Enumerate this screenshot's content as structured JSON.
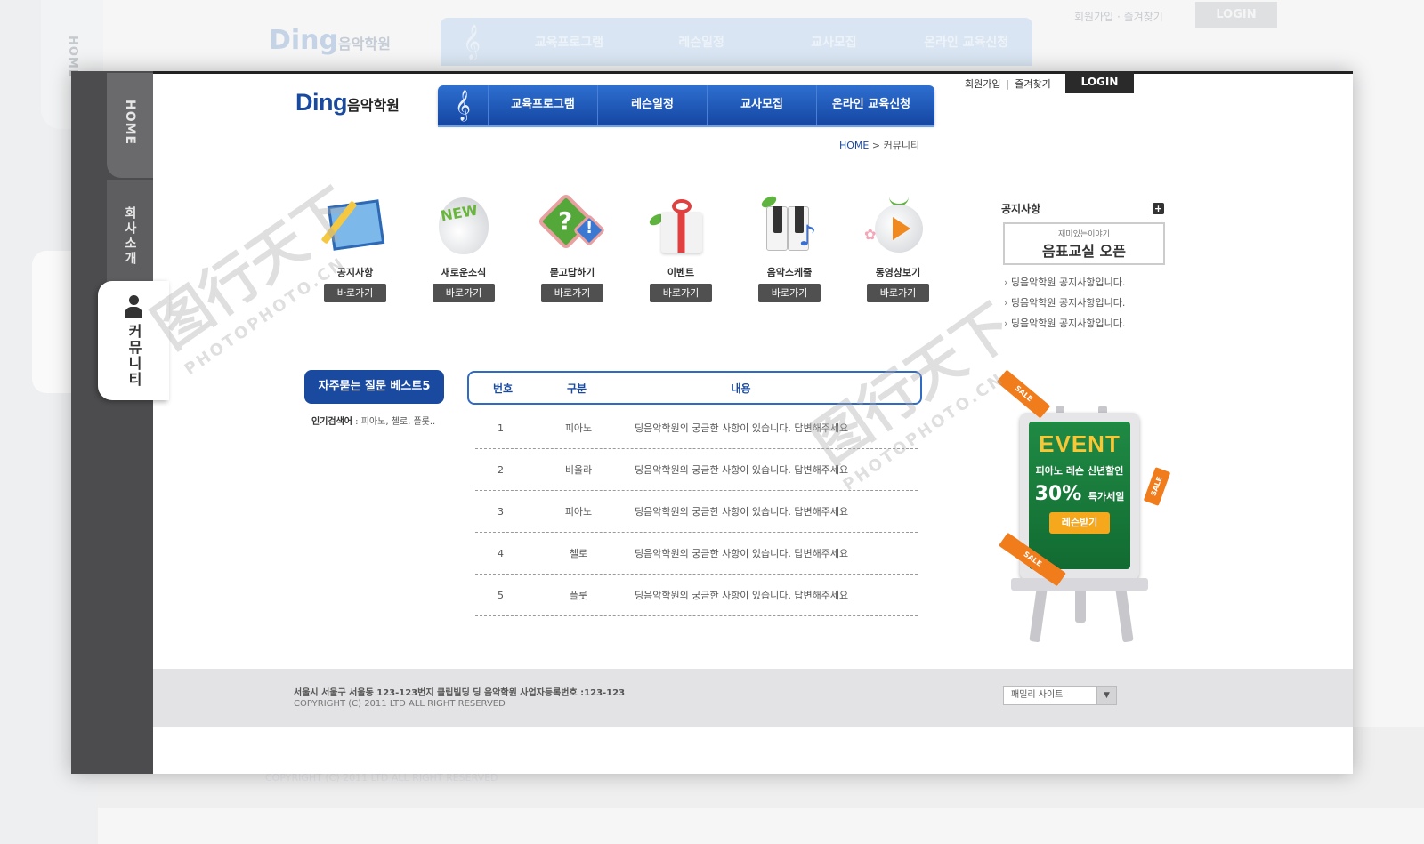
{
  "brand": {
    "name": "Ding",
    "sub": "음악학원"
  },
  "nav": {
    "clef_icon": "treble-clef-icon",
    "items": [
      "교육프로그램",
      "레슨일정",
      "교사모집",
      "온라인 교육신청"
    ]
  },
  "util": {
    "join": "회원가입",
    "favorite": "즐겨찾기",
    "login": "LOGIN"
  },
  "sidebar": {
    "home": "HOME",
    "about": "회사소개",
    "community": "커뮤니티"
  },
  "breadcrumb": {
    "home": "HOME",
    "sep": ">",
    "current": "커뮤니티"
  },
  "quick": {
    "items": [
      {
        "label": "공지사항",
        "button": "바로가기",
        "icon": "notice-board-icon"
      },
      {
        "label": "새로운소식",
        "button": "바로가기",
        "icon": "new-egg-icon"
      },
      {
        "label": "묻고답하기",
        "button": "바로가기",
        "icon": "question-answer-icon"
      },
      {
        "label": "이벤트",
        "button": "바로가기",
        "icon": "gift-box-icon"
      },
      {
        "label": "음악스케줄",
        "button": "바로가기",
        "icon": "piano-note-icon"
      },
      {
        "label": "동영상보기",
        "button": "바로가기",
        "icon": "video-play-icon"
      }
    ],
    "new_badge": "NEW"
  },
  "faq": {
    "title": "자주묻는 질문 베스트5",
    "popular_label": "인기검색어",
    "popular_values": "피아노, 첼로, 플룻..",
    "columns": [
      "번호",
      "구분",
      "내용"
    ],
    "rows": [
      {
        "num": "1",
        "cat": "피아노",
        "content": "딩음악학원의 궁금한 사항이 있습니다. 답변해주세요"
      },
      {
        "num": "2",
        "cat": "비올라",
        "content": "딩음악학원의 궁금한 사항이 있습니다. 답변해주세요"
      },
      {
        "num": "3",
        "cat": "피아노",
        "content": "딩음악학원의 궁금한 사항이 있습니다. 답변해주세요"
      },
      {
        "num": "4",
        "cat": "첼로",
        "content": "딩음악학원의 궁금한 사항이 있습니다. 답변해주세요"
      },
      {
        "num": "5",
        "cat": "플룻",
        "content": "딩음악학원의 궁금한 사항이 있습니다. 답변해주세요"
      }
    ]
  },
  "notice": {
    "title": "공지사항",
    "box_sub": "재미있는이야기",
    "box_main": "음표교실 오픈",
    "items": [
      "딩음악학원 공지사항입니다.",
      "딩음악학원 공지사항입니다.",
      "딩음악학원 공지사항입니다."
    ]
  },
  "event": {
    "title": "EVENT",
    "line1": "피아노 레슨 신년할인",
    "pct": "30%",
    "pct_sub": "특가세일",
    "cta": "레슨받기",
    "ribbon": "SALE"
  },
  "footer": {
    "address": "서울시 서울구 서울동 123-123번지 클립빌딩 딩 음악학원 사업자등록번호 :123-123",
    "copyright": "COPYRIGHT (C) 2011 LTD ALL RIGHT RESERVED",
    "family_site": "패밀리 사이트"
  },
  "watermark": {
    "text": "图行天下",
    "sub": "PHOTOPHOTO.CN"
  },
  "colors": {
    "primary": "#1a4aa0",
    "nav": "#1f5cc0",
    "sidebar": "#4c4c4e",
    "event_green": "#1f8a44",
    "accent_orange": "#f07c1c"
  }
}
